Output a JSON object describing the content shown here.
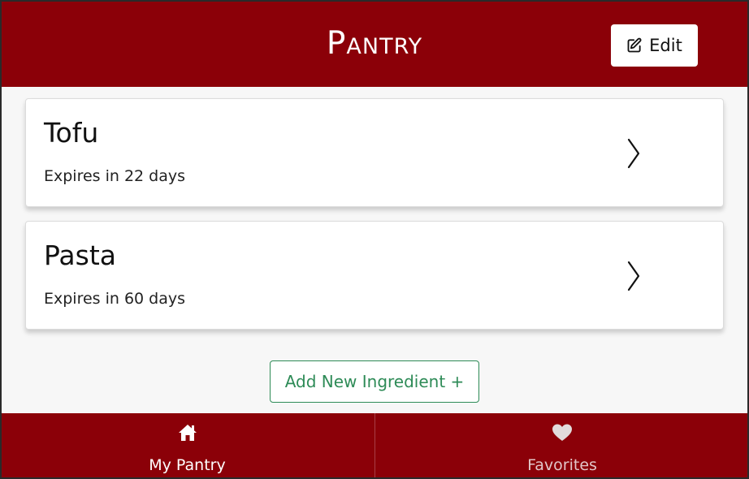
{
  "header": {
    "title": "Pantry",
    "edit_label": "Edit"
  },
  "items": [
    {
      "name": "Tofu",
      "expiry": "Expires in 22 days"
    },
    {
      "name": "Pasta",
      "expiry": "Expires in 60 days"
    }
  ],
  "add_button_label": "Add New Ingredient +",
  "tabs": [
    {
      "label": "My Pantry",
      "icon": "home-icon",
      "active": true
    },
    {
      "label": "Favorites",
      "icon": "heart-icon",
      "active": false
    }
  ],
  "colors": {
    "brand": "#8b0008",
    "accent": "#2e8b57",
    "background": "#f7f7f7"
  }
}
